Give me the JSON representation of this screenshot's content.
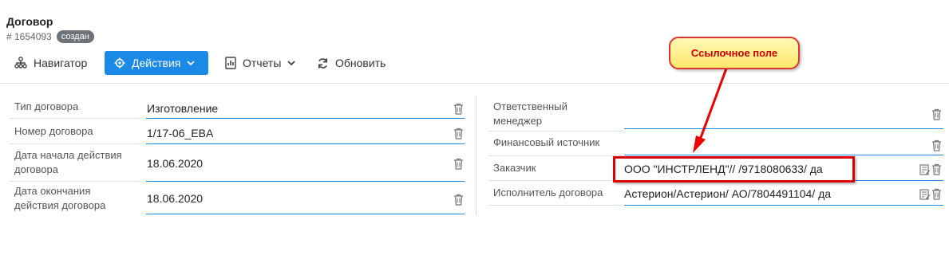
{
  "header": {
    "title": "Договор",
    "id": "# 1654093",
    "status": "создан"
  },
  "toolbar": {
    "navigator": "Навигатор",
    "actions": "Действия",
    "reports": "Отчеты",
    "refresh": "Обновить"
  },
  "left_fields": [
    {
      "label": "Тип договора",
      "value": "Изготовление"
    },
    {
      "label": "Номер договора",
      "value": "1/17-06_EBA"
    },
    {
      "label": "Дата начала действия договора",
      "value": "18.06.2020"
    },
    {
      "label": "Дата окончания действия договора",
      "value": "18.06.2020"
    }
  ],
  "right_fields": [
    {
      "label": "Ответственный менеджер",
      "value": ""
    },
    {
      "label": "Финансовый источник",
      "value": ""
    },
    {
      "label": "Заказчик",
      "value": "ООО \"ИНСТРЛЕНД\"// /9718080633/ да"
    },
    {
      "label": "Исполнитель договора",
      "value": "Астерион/Астерион/ АО/7804491104/ да"
    }
  ],
  "annotation": {
    "callout_text": "Ссылочное поле"
  },
  "colors": {
    "accent": "#1a8ae6",
    "badge": "#6e7378",
    "highlight": "#dd0000",
    "callout_bg": "#ffe86a"
  }
}
